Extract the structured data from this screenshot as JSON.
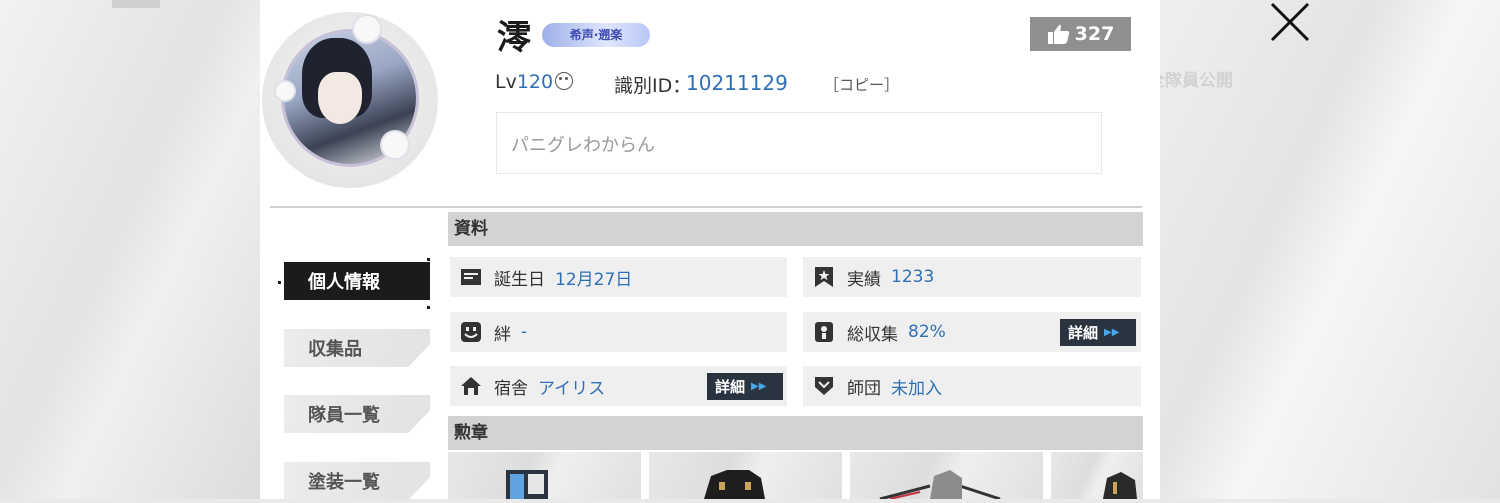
{
  "profile": {
    "name": "澪",
    "title_badge": "希声·遡楽",
    "likes": "327",
    "level_prefix": "Lv",
    "level": "120",
    "id_label": "識別ID：",
    "id_value": "10211129",
    "copy_label": "［コピー］",
    "comment": "パニグレわからん"
  },
  "background": {
    "ghost_text": "全隊員公開"
  },
  "sidebar": {
    "items": [
      {
        "label": "個人情報",
        "active": true
      },
      {
        "label": "収集品",
        "active": false
      },
      {
        "label": "隊員一覧",
        "active": false
      },
      {
        "label": "塗装一覧",
        "active": false
      }
    ]
  },
  "sections": {
    "info_header": "資料",
    "medals_header": "勲章"
  },
  "fields": {
    "birthday": {
      "label": "誕生日",
      "value": "12月27日",
      "icon": "id-card-icon"
    },
    "achievements": {
      "label": "実績",
      "value": "1233",
      "icon": "star-flag-icon"
    },
    "bond": {
      "label": "絆",
      "value": "-",
      "icon": "smile-face-icon"
    },
    "collection": {
      "label": "総収集",
      "value": "82%",
      "icon": "collection-icon"
    },
    "dorm": {
      "label": "宿舎",
      "value": "アイリス",
      "icon": "home-icon"
    },
    "guild": {
      "label": "師団",
      "value": "未加入",
      "icon": "shield-icon"
    }
  },
  "buttons": {
    "detail_label": "詳細"
  },
  "colors": {
    "accent_blue": "#2f6fb5",
    "active_tab": "#1b1b1b",
    "detail_button": "#2a3441",
    "like_box": "#8f8f8f"
  }
}
